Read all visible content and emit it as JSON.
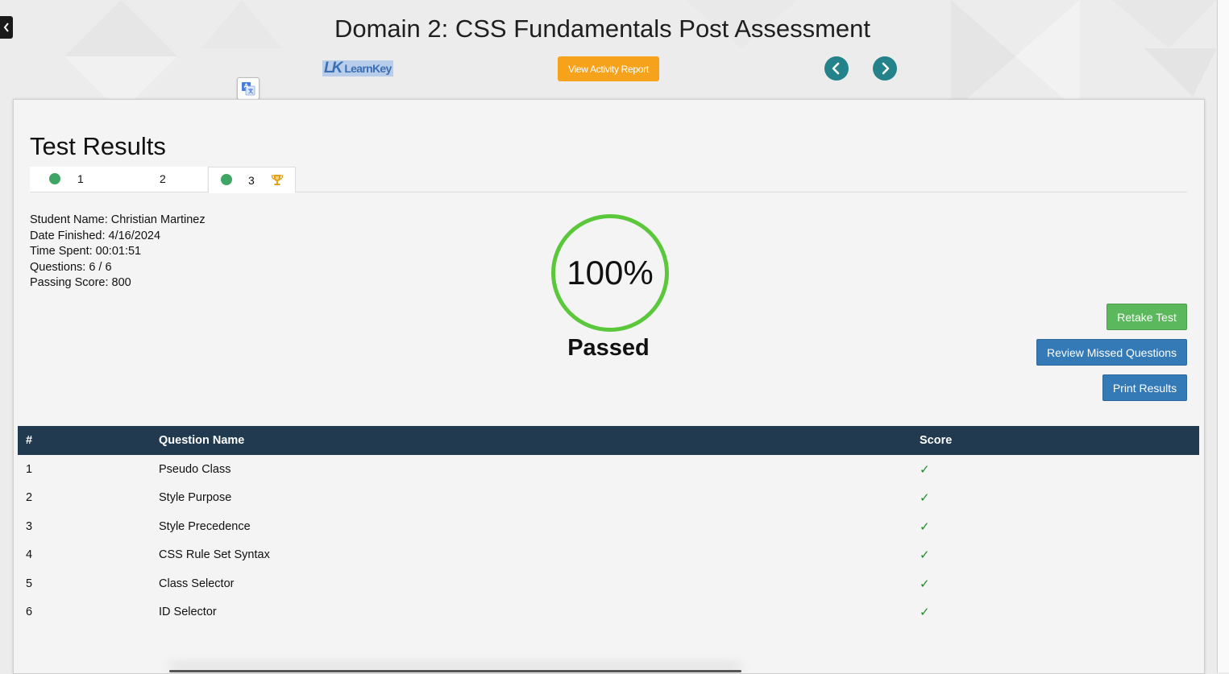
{
  "header": {
    "title": "Domain 2: CSS Fundamentals Post Assessment",
    "logo_mark": "LK",
    "logo_text": "LearnKey",
    "activity_button_label": "View Activity Report"
  },
  "results": {
    "title": "Test Results",
    "tabs": [
      {
        "label": "1",
        "status": "completed"
      },
      {
        "label": "2",
        "status": "none"
      },
      {
        "label": "3",
        "status": "completed",
        "active": true,
        "badge": "trophy-icon"
      }
    ],
    "info": {
      "student_name": "Student Name: Christian Martinez",
      "date_finished": "Date Finished: 4/16/2024",
      "time_spent": "Time Spent: 00:01:51",
      "questions": "Questions: 6 / 6",
      "passing_score": "Passing Score: 800"
    },
    "score": {
      "value": "100%",
      "status": "Passed",
      "ring_color": "#5ac83a"
    },
    "buttons": {
      "retake": "Retake Test",
      "review": "Review Missed Questions",
      "print": "Print Results"
    },
    "table": {
      "headers": [
        "#",
        "Question Name",
        "Score"
      ],
      "rows": [
        {
          "num": "1",
          "name": "Pseudo Class",
          "score": "correct"
        },
        {
          "num": "2",
          "name": "Style Purpose",
          "score": "correct"
        },
        {
          "num": "3",
          "name": "Style Precedence",
          "score": "correct"
        },
        {
          "num": "4",
          "name": "CSS Rule Set Syntax",
          "score": "correct"
        },
        {
          "num": "5",
          "name": "Class Selector",
          "score": "correct"
        },
        {
          "num": "6",
          "name": "ID Selector",
          "score": "correct"
        }
      ]
    }
  },
  "colors": {
    "accent_orange": "#f7a21b",
    "nav_teal": "#24838a",
    "pass_green": "#5cb85c",
    "primary_blue": "#337ab7",
    "table_header": "#213a50",
    "check_green": "#1e8a2a"
  }
}
